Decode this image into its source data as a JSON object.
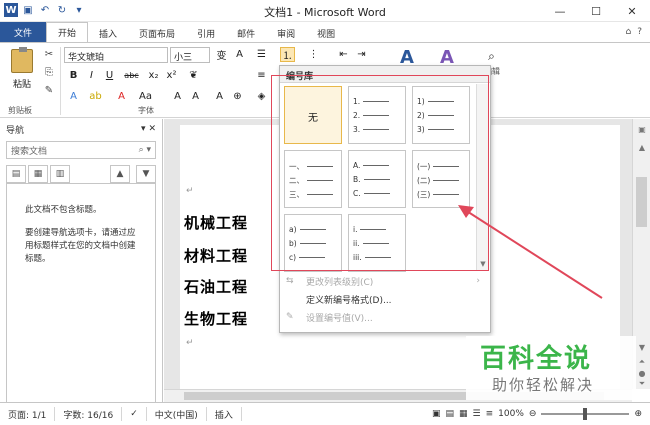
{
  "titlebar": {
    "title": "文档1 - Microsoft Word",
    "app_logo": "W"
  },
  "tabs": [
    "文件",
    "开始",
    "插入",
    "页面布局",
    "引用",
    "邮件",
    "审阅",
    "视图"
  ],
  "ribbon": {
    "paste_label": "粘贴",
    "clipboard_label": "剪贴板",
    "font_label": "字体",
    "font_name": "华文琥珀",
    "font_size": "小三",
    "font_buttons": [
      "B",
      "I",
      "U",
      "abc",
      "x₂",
      "x²"
    ],
    "edit_label": "编辑"
  },
  "nav": {
    "title": "导航",
    "search_placeholder": "搜索文档",
    "empty_title": "此文档不包含标题。",
    "empty_hint": "要创建导航选项卡，请通过应用标题样式在您的文档中创建标题。"
  },
  "document": {
    "lines": [
      "机械工程",
      "材料工程",
      "石油工程",
      "生物工程"
    ]
  },
  "numbering": {
    "header": "编号库",
    "none_label": "无",
    "formats": [
      [
        "1.",
        "2.",
        "3."
      ],
      [
        "1)",
        "2)",
        "3)"
      ],
      [
        "一、",
        "二、",
        "三、"
      ],
      [
        "A.",
        "B.",
        "C."
      ],
      [
        "(一)",
        "(二)",
        "(三)"
      ],
      [
        "a)",
        "b)",
        "c)"
      ],
      [
        "i.",
        "ii.",
        "iii."
      ]
    ],
    "menu": [
      {
        "label": "更改列表级别(C)",
        "disabled": true
      },
      {
        "label": "定义新编号格式(D)...",
        "disabled": false
      },
      {
        "label": "设置编号值(V)...",
        "disabled": true
      }
    ]
  },
  "status": {
    "page": "页面: 1/1",
    "words": "字数: 16/16",
    "lang": "中文(中国)",
    "mode": "插入",
    "zoom": "100%"
  },
  "watermark": {
    "title": "百科全说",
    "subtitle": "助你轻松解决"
  },
  "colors": {
    "accent": "#2b579a",
    "highlight": "#e0475a",
    "watermark": "#3bb54a"
  }
}
